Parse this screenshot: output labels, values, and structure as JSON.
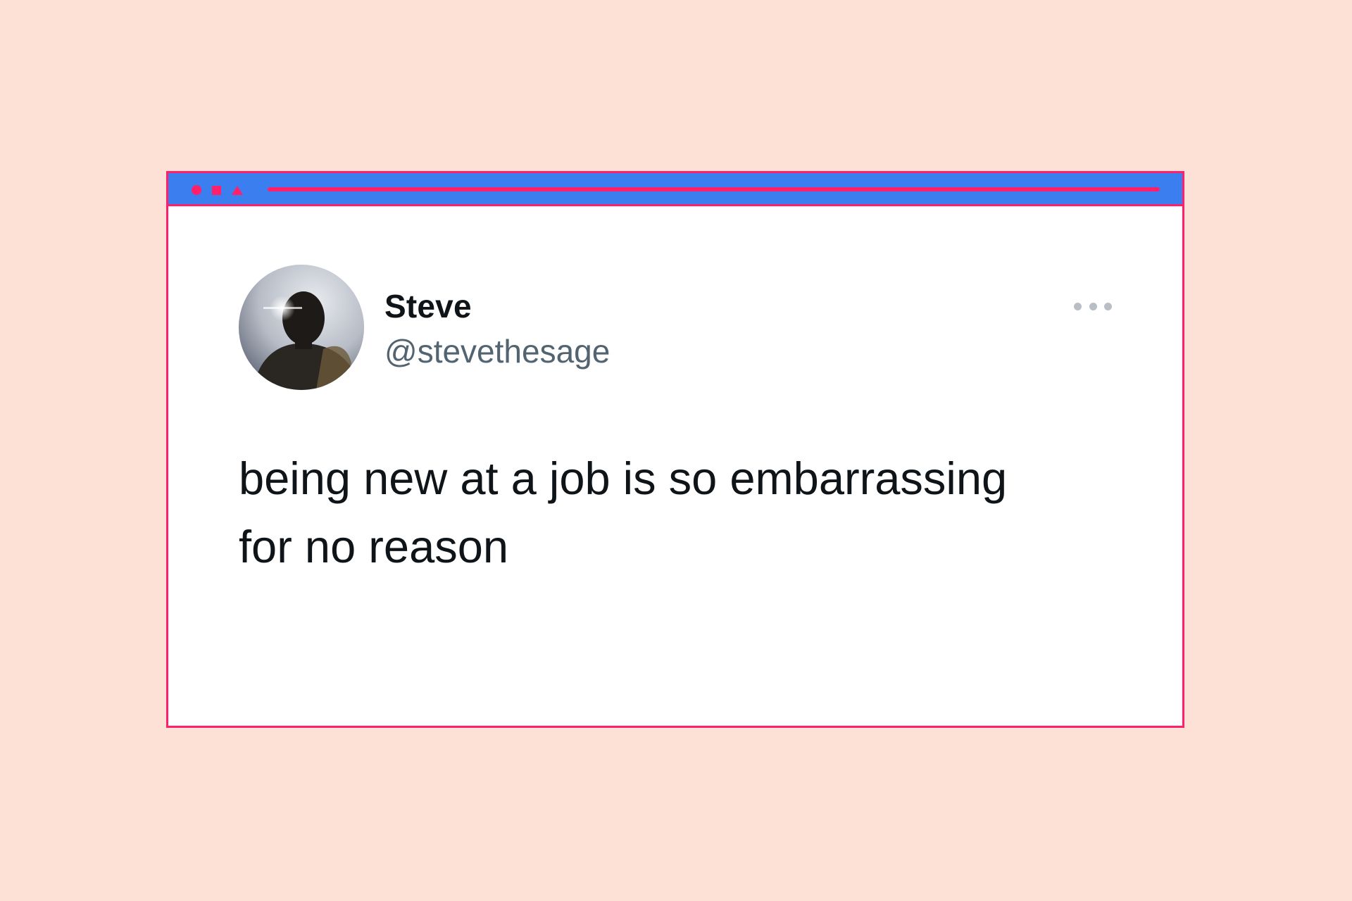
{
  "window": {
    "title_controls": [
      "circle-icon",
      "square-icon",
      "triangle-icon"
    ]
  },
  "tweet": {
    "author": {
      "name": "Steve",
      "handle": "@stevethesage",
      "avatar_icon": "profile-photo"
    },
    "more_icon": "more-options-icon",
    "text": "being new at a job is so embarrassing\nfor no reason"
  },
  "colors": {
    "page_background": "#fde1d6",
    "window_accent": "#ff1f6b",
    "titlebar": "#3b7ef0",
    "name_text": "#0f1419",
    "handle_text": "#536471"
  }
}
